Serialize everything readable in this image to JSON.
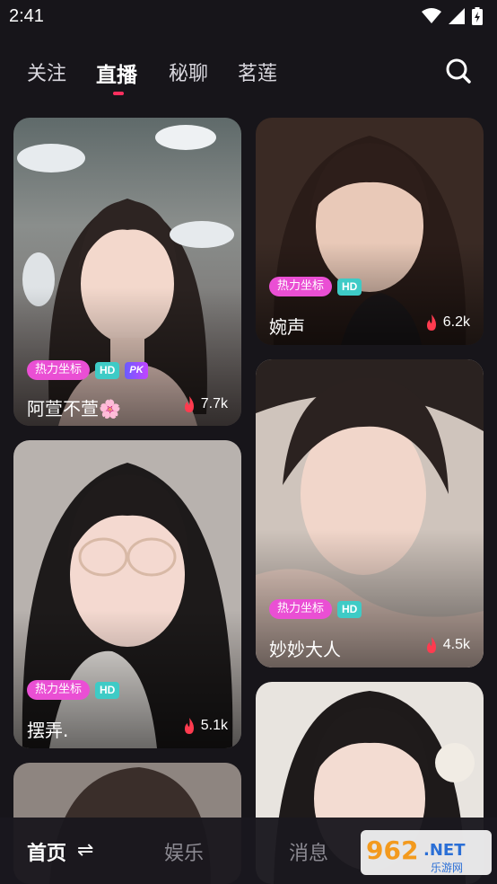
{
  "status": {
    "time": "2:41"
  },
  "tabs": [
    {
      "label": "关注",
      "active": false
    },
    {
      "label": "直播",
      "active": true
    },
    {
      "label": "秘聊",
      "active": false
    },
    {
      "label": "茗莲",
      "active": false
    }
  ],
  "search": {
    "icon": "search-icon"
  },
  "cards": [
    {
      "name": "阿萱不萱🌸",
      "views": "7.7k",
      "badges": {
        "hot": "热力坐标",
        "hd": "HD",
        "pk": "PK"
      }
    },
    {
      "name": "婉声",
      "views": "6.2k",
      "badges": {
        "hot": "热力坐标",
        "hd": "HD"
      }
    },
    {
      "name": "妙妙大人",
      "views": "4.5k",
      "badges": {
        "hot": "热力坐标",
        "hd": "HD"
      }
    },
    {
      "name": "摆弄.",
      "views": "5.1k",
      "badges": {
        "hot": "热力坐标",
        "hd": "HD"
      }
    },
    {
      "name": "",
      "views": ""
    },
    {
      "name": "",
      "views": ""
    }
  ],
  "bottom_nav": [
    {
      "label": "首页",
      "active": true
    },
    {
      "label": "娱乐",
      "active": false
    },
    {
      "label": "消息",
      "active": false
    }
  ],
  "watermark": {
    "main": "962",
    "suffix": ".NET",
    "sub": "乐游网"
  },
  "colors": {
    "accent": "#ff2f5e",
    "hot_badge": "#ea4fd4",
    "hd_badge": "#3ecbc6",
    "background": "#17151a"
  }
}
